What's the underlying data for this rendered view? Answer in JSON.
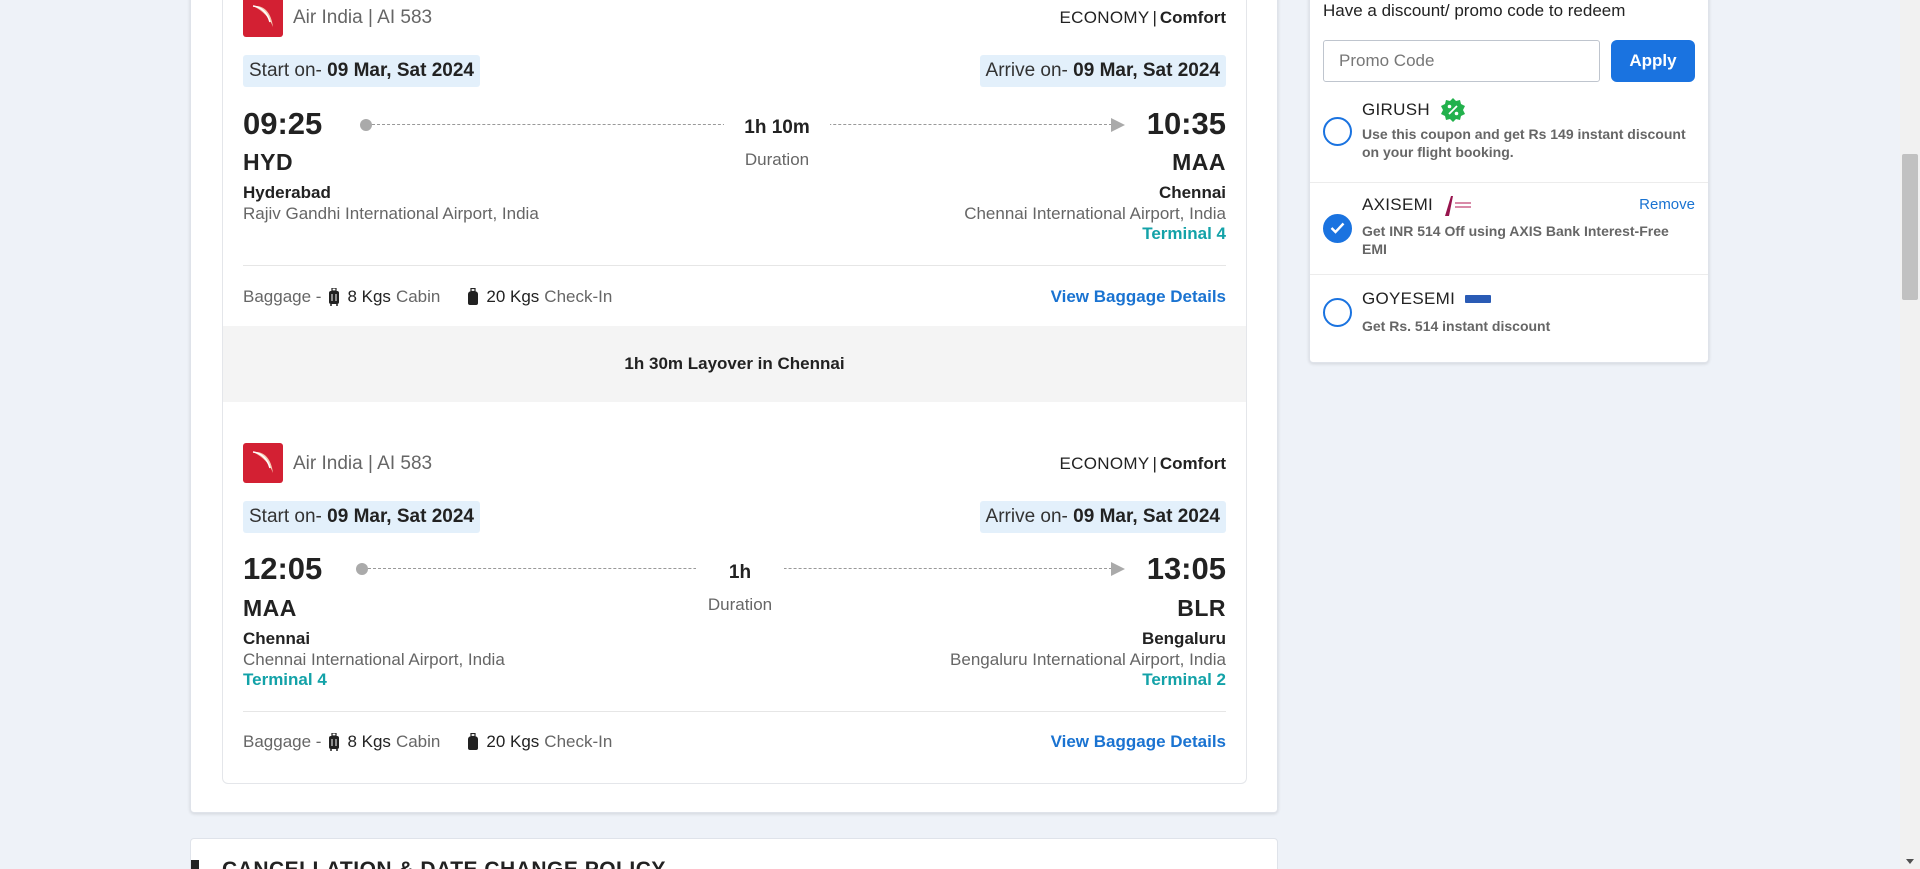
{
  "segments": [
    {
      "airline": "Air India | AI 583",
      "cabin": {
        "class": "ECONOMY",
        "sep": "|",
        "fare": "Comfort"
      },
      "start": {
        "label": "Start on- ",
        "date": "09 Mar, Sat 2024"
      },
      "arrive": {
        "label": "Arrive on- ",
        "date": "09 Mar, Sat 2024"
      },
      "dep_time": "09:25",
      "arr_time": "10:35",
      "dep_code": "HYD",
      "arr_code": "MAA",
      "duration": "1h 10m",
      "duration_label": "Duration",
      "dep_city": "Hyderabad",
      "dep_airport": "Rajiv Gandhi International Airport, India",
      "dep_terminal": "",
      "arr_city": "Chennai",
      "arr_airport": "Chennai International Airport, India",
      "arr_terminal": "Terminal 4",
      "baggage": {
        "label": "Baggage - ",
        "cabin_val": "8 Kgs",
        "cabin_unit": "Cabin",
        "checkin_val": "20 Kgs",
        "checkin_unit": "Check-In",
        "link": "View Baggage Details"
      }
    },
    {
      "airline": "Air India | AI 583",
      "cabin": {
        "class": "ECONOMY",
        "sep": "|",
        "fare": "Comfort"
      },
      "start": {
        "label": "Start on- ",
        "date": "09 Mar, Sat 2024"
      },
      "arrive": {
        "label": "Arrive on- ",
        "date": "09 Mar, Sat 2024"
      },
      "dep_time": "12:05",
      "arr_time": "13:05",
      "dep_code": "MAA",
      "arr_code": "BLR",
      "duration": "1h",
      "duration_label": "Duration",
      "dep_city": "Chennai",
      "dep_airport": "Chennai International Airport, India",
      "dep_terminal": "Terminal 4",
      "arr_city": "Bengaluru",
      "arr_airport": "Bengaluru International Airport, India",
      "arr_terminal": "Terminal 2",
      "baggage": {
        "label": "Baggage - ",
        "cabin_val": "8 Kgs",
        "cabin_unit": "Cabin",
        "checkin_val": "20 Kgs",
        "checkin_unit": "Check-In",
        "link": "View Baggage Details"
      }
    }
  ],
  "layover": "1h 30m Layover in Chennai",
  "cancellation": {
    "title": "CANCELLATION & DATE CHANGE POLICY"
  },
  "promo": {
    "heading": "Have a discount/ promo code to redeem",
    "placeholder": "Promo Code",
    "apply_label": "Apply",
    "coupons": [
      {
        "code": "GIRUSH",
        "desc": "Use this coupon and get Rs 149 instant discount on your flight booking.",
        "selected": false,
        "icon": "discount-badge-icon"
      },
      {
        "code": "AXISEMI",
        "desc": "Get INR 514 Off using AXIS Bank Interest-Free EMI",
        "selected": true,
        "remove_label": "Remove",
        "icon": "axis-bank-logo"
      },
      {
        "code": "GOYESEMI",
        "desc": "Get Rs. 514 instant discount",
        "selected": false,
        "icon": "yes-bank-logo"
      }
    ]
  },
  "colors": {
    "accent": "#1a73e0",
    "terminal": "#13a2a8",
    "airline_red": "#d32033",
    "date_pill": "#e3f0fb"
  }
}
